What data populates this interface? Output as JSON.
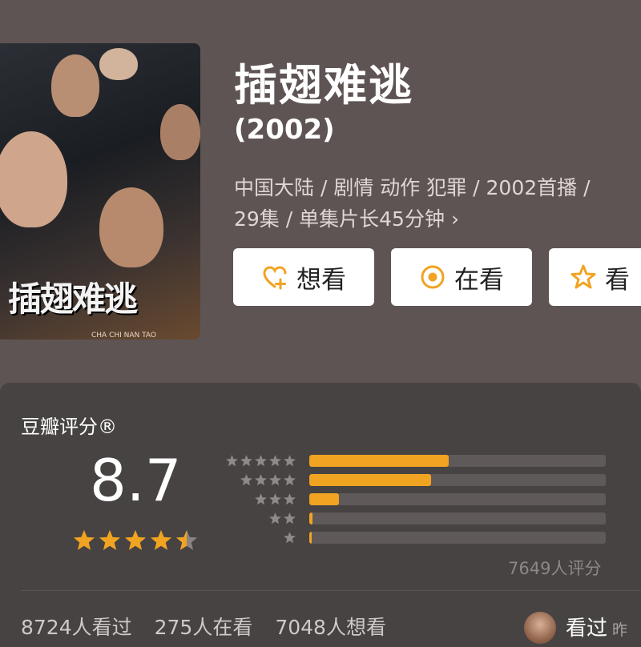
{
  "poster": {
    "title_text": "插翅难逃",
    "subtitle_text": "CHA CHI NAN TAO"
  },
  "movie": {
    "title": "插翅难逃",
    "year": "(2002)",
    "meta_line1": "中国大陆 / 剧情 动作 犯罪 / 2002首播 /",
    "meta_line2": "29集 / 单集片长45分钟",
    "meta_chevron": "›"
  },
  "actions": {
    "want": "想看",
    "watching": "在看",
    "watched": "看"
  },
  "rating": {
    "label": "豆瓣评分®",
    "score": "8.7",
    "stars": 4.5,
    "distribution": [
      {
        "stars": 5,
        "fraction": 0.47
      },
      {
        "stars": 4,
        "fraction": 0.41
      },
      {
        "stars": 3,
        "fraction": 0.1
      },
      {
        "stars": 2,
        "fraction": 0.01
      },
      {
        "stars": 1,
        "fraction": 0.005
      }
    ],
    "count_text": "7649人评分"
  },
  "stats": {
    "watched": "8724人看过",
    "watching": "275人在看",
    "want": "7048人想看"
  },
  "footer": {
    "seen_label": "看过",
    "seen_suffix": "昨"
  },
  "colors": {
    "accent": "#f1a322",
    "background": "#5e5453",
    "panel": "#474342"
  }
}
